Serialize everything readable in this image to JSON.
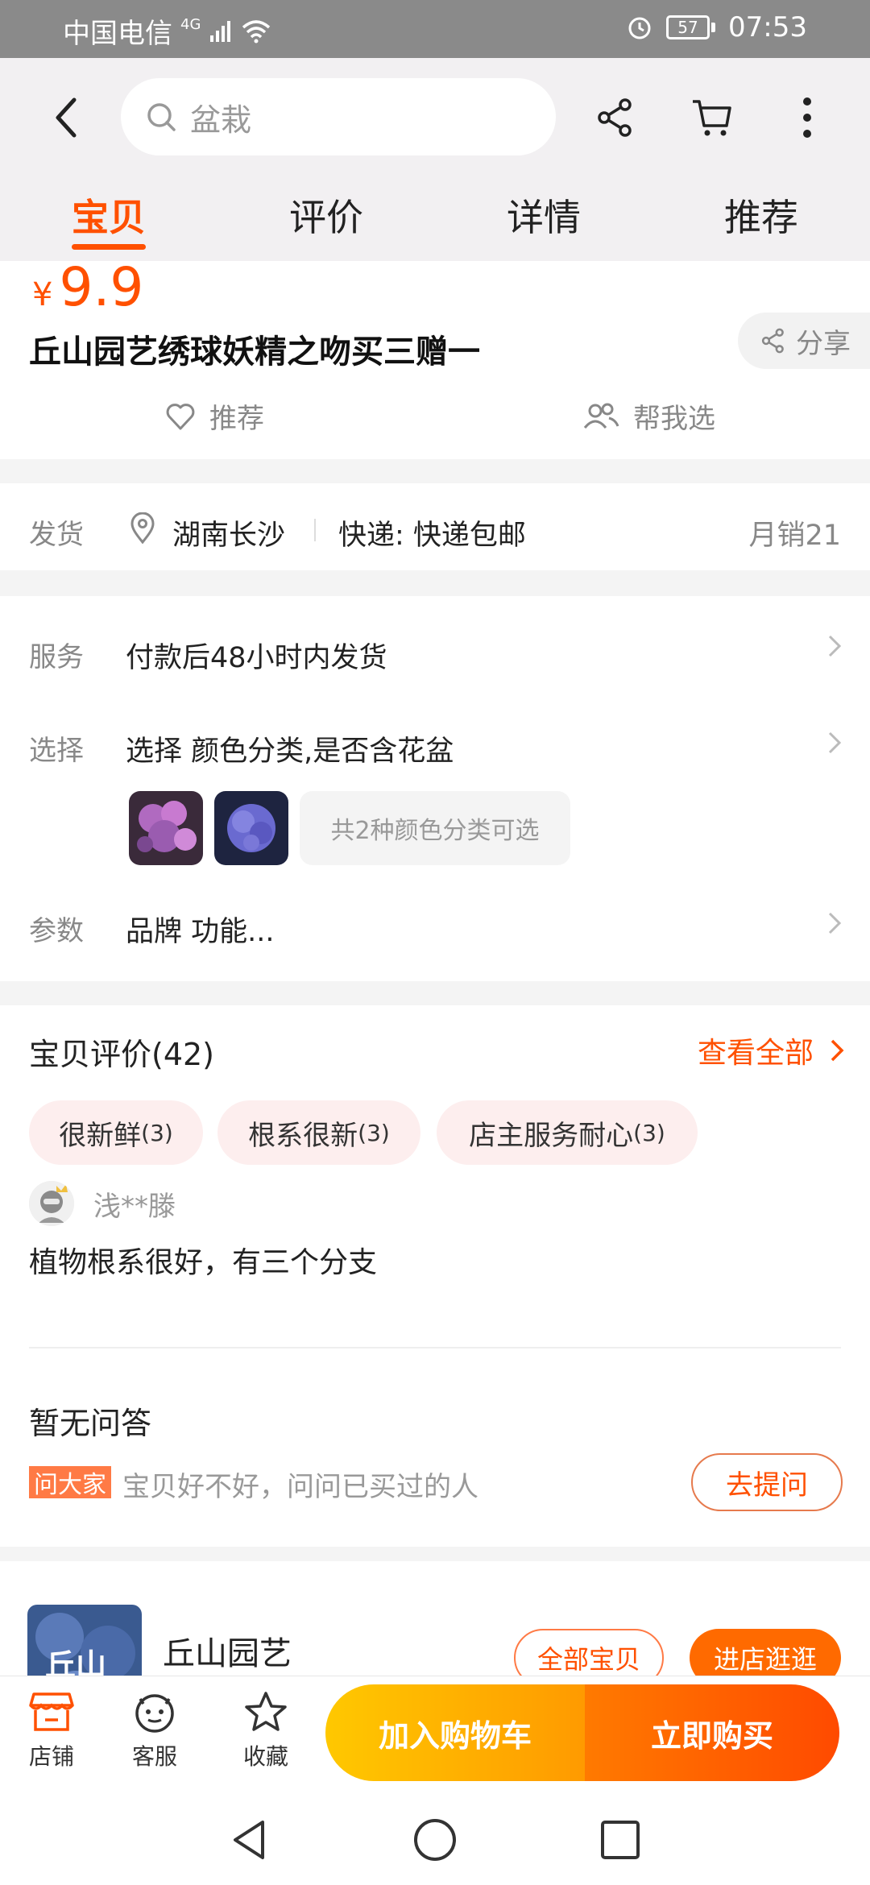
{
  "status_bar": {
    "carrier": "中国电信",
    "network": "4G",
    "battery": "57",
    "time": "07:53"
  },
  "header": {
    "search_placeholder": "盆栽",
    "tabs": [
      {
        "label": "宝贝",
        "active": true
      },
      {
        "label": "评价",
        "active": false
      },
      {
        "label": "详情",
        "active": false
      },
      {
        "label": "推荐",
        "active": false
      }
    ]
  },
  "product": {
    "currency": "¥",
    "price": "9.9",
    "title": "丘山园艺绣球妖精之吻买三赠一",
    "share_label": "分享",
    "recommend_label": "推荐",
    "help_choose_label": "帮我选"
  },
  "shipping": {
    "label": "发货",
    "location": "湖南长沙",
    "express": "快递: 快递包邮",
    "monthly_sales": "月销21"
  },
  "service": {
    "service_label": "服务",
    "service_value": "付款后48小时内发货",
    "select_label": "选择",
    "select_value": "选择 颜色分类,是否含花盆",
    "options_hint": "共2种颜色分类可选",
    "params_label": "参数",
    "params_value": "品牌 功能..."
  },
  "reviews": {
    "title": "宝贝评价(42)",
    "see_all": "查看全部",
    "tags": [
      {
        "text": "很新鲜",
        "count": "(3)"
      },
      {
        "text": "根系很新",
        "count": "(3)"
      },
      {
        "text": "店主服务耐心",
        "count": "(3)"
      }
    ],
    "reviewer": "浅**滕",
    "review_text": "植物根系很好，有三个分支"
  },
  "qa": {
    "title": "暂无问答",
    "badge": "问大家",
    "hint": "宝贝好不好，问问已买过的人",
    "ask_button": "去提问"
  },
  "shop": {
    "name": "丘山园艺",
    "logo_text": "丘山",
    "all_items_button": "全部宝贝",
    "visit_button": "进店逛逛"
  },
  "bottom_bar": {
    "shop": "店铺",
    "service": "客服",
    "favorite": "收藏",
    "add_to_cart": "加入购物车",
    "buy_now": "立即购买"
  },
  "colors": {
    "accent": "#ff5000",
    "cart_gradient_start": "#ffc800",
    "buy_gradient_end": "#ff4a00"
  }
}
